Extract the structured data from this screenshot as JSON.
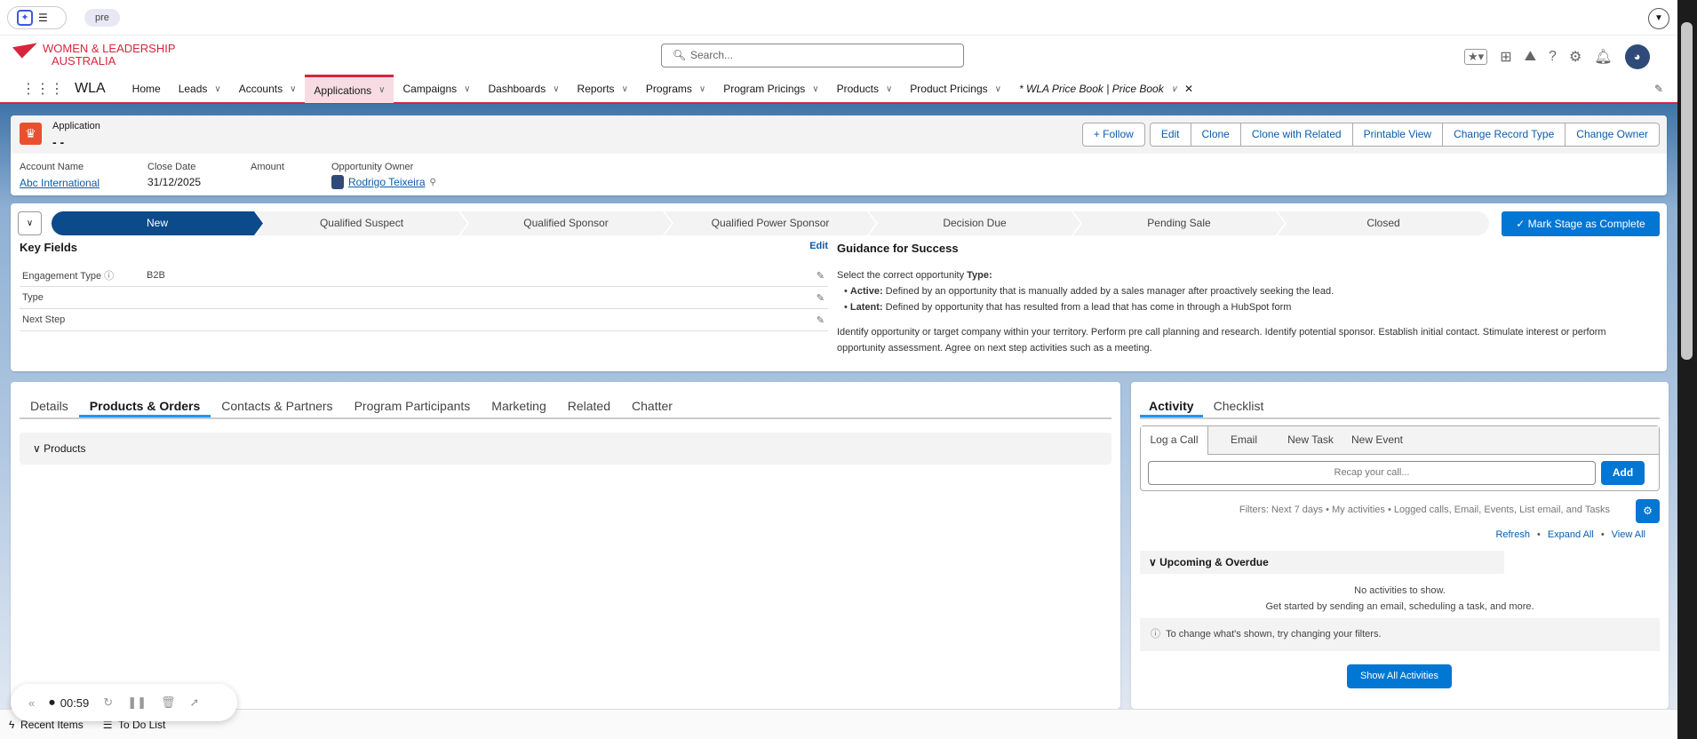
{
  "browser": {
    "tab_label": "pre"
  },
  "logo": {
    "line1": "WOMEN & LEADERSHIP",
    "line2": "AUSTRALIA"
  },
  "search": {
    "placeholder": "Search..."
  },
  "nav": {
    "app": "WLA",
    "items": [
      "Home",
      "Leads",
      "Accounts",
      "Applications",
      "Campaigns",
      "Dashboards",
      "Reports",
      "Programs",
      "Program Pricings",
      "Products",
      "Product Pricings"
    ],
    "open_tab": "* WLA Price Book | Price Book",
    "active": "Applications"
  },
  "record": {
    "object": "Application",
    "name": "- -",
    "buttons": [
      "Edit",
      "Clone",
      "Clone with Related",
      "Printable View",
      "Change Record Type",
      "Change Owner"
    ],
    "follow": "Follow",
    "fields": [
      {
        "label": "Account Name",
        "value": "Abc International"
      },
      {
        "label": "Close Date",
        "value": "31/12/2025"
      },
      {
        "label": "Amount",
        "value": ""
      },
      {
        "label": "Opportunity Owner",
        "value": "Rodrigo Teixeira"
      }
    ]
  },
  "path": {
    "stages": [
      "New",
      "Qualified Suspect",
      "Qualified Sponsor",
      "Qualified Power Sponsor",
      "Decision Due",
      "Pending Sale",
      "Closed"
    ],
    "current": "New",
    "complete_button": "Mark Stage as Complete"
  },
  "key_fields": {
    "title": "Key Fields",
    "edit": "Edit",
    "rows": [
      {
        "label": "Engagement Type",
        "value": "B2B"
      },
      {
        "label": "Type",
        "value": ""
      },
      {
        "label": "Next Step",
        "value": ""
      }
    ]
  },
  "guidance": {
    "title": "Guidance for Success",
    "intro": "Select the correct opportunity ",
    "intro_bold": "Type:",
    "bullets": [
      {
        "term": "Active:",
        "text": " Defined by an opportunity that is manually added by a sales manager after proactively seeking the lead."
      },
      {
        "term": "Latent:",
        "text": " Defined by opportunity that has resulted from a lead that has come in through a HubSpot form"
      }
    ],
    "body": "Identify opportunity or target company within your territory. Perform pre call planning and research. Identify potential sponsor. Establish initial contact. Stimulate interest or perform opportunity assessment. Agree on next step activities such as a meeting."
  },
  "tabs": {
    "items": [
      "Details",
      "Products & Orders",
      "Contacts & Partners",
      "Program Participants",
      "Marketing",
      "Related",
      "Chatter"
    ],
    "active": "Products & Orders",
    "section": "Products"
  },
  "activity": {
    "tabs": [
      "Activity",
      "Checklist"
    ],
    "subtabs": [
      "Log a Call",
      "Email",
      "New Task",
      "New Event"
    ],
    "placeholder": "Recap your call...",
    "add": "Add",
    "filters": "Filters: Next 7 days • My activities • Logged calls, Email, Events, List email, and Tasks",
    "links": [
      "Refresh",
      "Expand All",
      "View All"
    ],
    "section": "Upcoming & Overdue",
    "empty1": "No activities to show.",
    "empty2": "Get started by sending an email, scheduling a task, and more.",
    "info": "To change what's shown, try changing your filters.",
    "show_all": "Show All Activities"
  },
  "recorder": {
    "time": "00:59"
  },
  "footer": {
    "items": [
      "Recent Items",
      "To Do List"
    ]
  }
}
